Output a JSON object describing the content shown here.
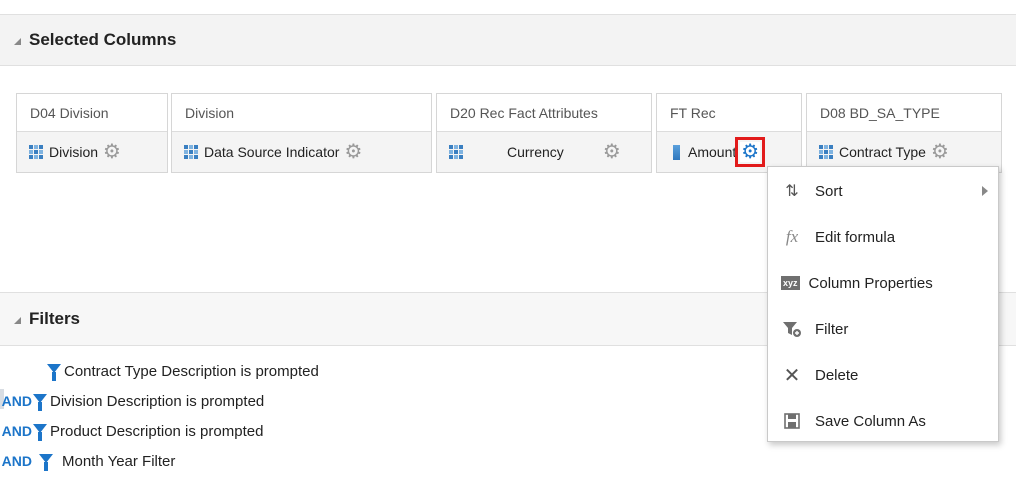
{
  "selected_columns": {
    "title": "Selected Columns",
    "columns": [
      {
        "header": "D04 Division",
        "item": "Division",
        "icon": "grid-icon"
      },
      {
        "header": "Division",
        "item": "Data Source Indicator",
        "icon": "grid-icon"
      },
      {
        "header": "D20 Rec Fact Attributes",
        "item": "Currency",
        "icon": "grid-icon"
      },
      {
        "header": "FT Rec",
        "item": "Amount",
        "icon": "measure-icon"
      },
      {
        "header": "D08 BD_SA_TYPE",
        "item": "Contract Type",
        "icon": "grid-icon"
      }
    ]
  },
  "context_menu": {
    "items": [
      {
        "label": "Sort",
        "icon": "sort-icon",
        "has_submenu": true
      },
      {
        "label": "Edit formula",
        "icon": "fx-icon"
      },
      {
        "label": "Column Properties",
        "icon": "xyz-icon"
      },
      {
        "label": "Filter",
        "icon": "add-filter-icon"
      },
      {
        "label": "Delete",
        "icon": "delete-icon"
      },
      {
        "label": "Save Column As",
        "icon": "save-icon"
      }
    ],
    "fx_glyph": "fx",
    "xyz_glyph": "xyz"
  },
  "filters": {
    "title": "Filters",
    "items": [
      {
        "operator": "",
        "text": "Contract Type Description is prompted"
      },
      {
        "operator": "AND",
        "text": "Division Description is prompted"
      },
      {
        "operator": "AND",
        "text": "Product Description is prompted"
      },
      {
        "operator": "AND",
        "text": "Month Year Filter"
      }
    ]
  },
  "colors": {
    "accent": "#1c75c9",
    "highlight_border": "#e21b1b",
    "gear_inactive": "#9a9a9a"
  }
}
